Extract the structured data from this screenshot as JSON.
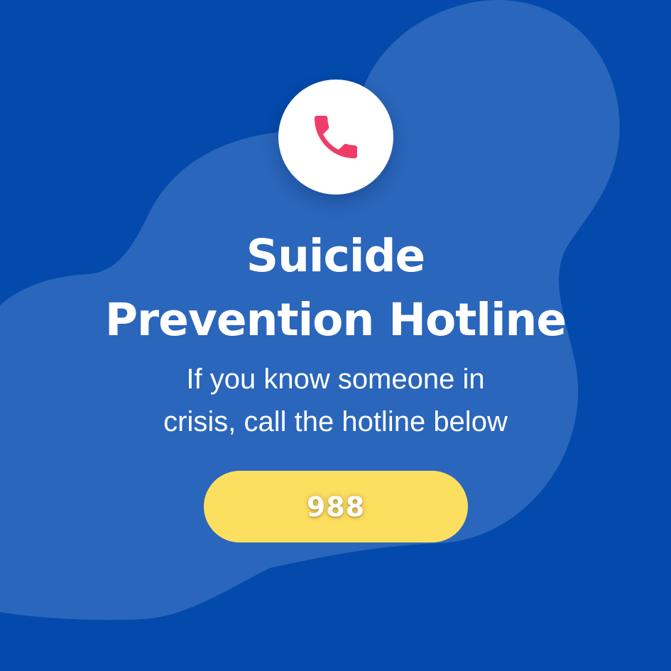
{
  "colors": {
    "background": "#034AAC",
    "blob": "#2A66BB",
    "icon_circle": "#FFFFFF",
    "phone_icon": "#EE3D69",
    "button": "#FDDF60",
    "text": "#FFFFFF"
  },
  "icon": {
    "name": "phone-icon"
  },
  "title": {
    "line1": "Suicide",
    "line2": "Prevention Hotline"
  },
  "subtitle": {
    "line1": "If you know someone in",
    "line2": "crisis, call the hotline below"
  },
  "hotline": {
    "number": "988"
  }
}
